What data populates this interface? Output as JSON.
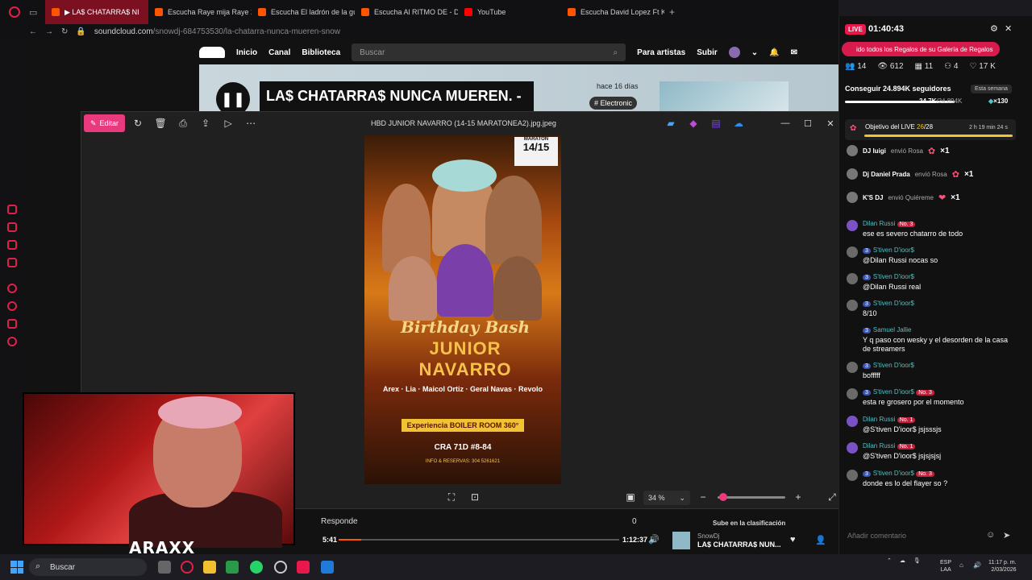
{
  "browser": {
    "tabs": [
      {
        "label": "▶ LA$ CHATARRA$ NI",
        "icon": "soundcloud-icon",
        "active": true
      },
      {
        "label": "Escucha Raye mija Raye 2",
        "icon": "soundcloud-icon"
      },
      {
        "label": "Escucha El ladrón de la gu",
        "icon": "soundcloud-icon"
      },
      {
        "label": "Escucha Al RITMO DE - D",
        "icon": "soundcloud-icon"
      },
      {
        "label": "YouTube",
        "icon": "youtube-icon"
      },
      {
        "label": "Escucha David Lopez Ft K",
        "icon": "soundcloud-icon"
      }
    ],
    "url_host": "soundcloud.com",
    "url_path": "/snowdj-684753530/la-chatarra-nunca-mueren-snow"
  },
  "soundcloud": {
    "nav": [
      "Inicio",
      "Canal",
      "Biblioteca"
    ],
    "search_placeholder": "Buscar",
    "para_artistas": "Para artistas",
    "subir": "Subir",
    "hero_title": "LA$ CHATARRA$ NUNCA MUEREN. -",
    "hero_ago": "hace 16 días",
    "hero_tag": "# Electronic",
    "responde": "Responde",
    "responde_count": "0",
    "sube": "Sube en la clasificación",
    "time_current": "5:41",
    "time_total": "1:12:37",
    "progress": 0.08,
    "track_user": "SnowDj",
    "track_title": "LA$ CHATARRA$ NUN..."
  },
  "viewer": {
    "edit_label": "Editar",
    "title": "HBD JUNIOR NAVARRO (14-15 MARATONEA2).jpg.jpeg",
    "zoom": "34 %",
    "zoom_level": 0.05,
    "poster": {
      "date_label": "MARATÓN",
      "date": "14/15",
      "bday": "Birthday Bash",
      "name": "JUNIOR NAVARRO",
      "artists": "Arex · Lia · Maicol Ortiz · Geral Navas · Revolo",
      "experience": "Experiencia BOILER ROOM 360°",
      "address": "CRA 71D #8-84",
      "info": "INFO & RESERVAS: 304 5261621"
    }
  },
  "webcam": {
    "logo": "ARAXX"
  },
  "live": {
    "badge": "LIVE",
    "time": "01:40:43",
    "gifts_banner": "ido todos los Regalos de su Galería de Regalos",
    "stats": [
      "14",
      "612",
      "11",
      "4",
      "17 K"
    ],
    "goal": "Conseguir 24.894K seguidores",
    "goal_period": "Esta semana",
    "goal_current": "24.7K",
    "goal_target": "/24.894K",
    "goal_coins": "×130",
    "objective_label": "Objetivo del LIVE",
    "objective_current": "26",
    "objective_total": "/28",
    "objective_time": "2 h 19 min 24 s",
    "gifts": [
      {
        "user": "DJ luigi",
        "action": "envió Rosa",
        "count": "×1"
      },
      {
        "user": "Dj Daniel Prada",
        "action": "envió Rosa",
        "count": "×1"
      },
      {
        "user": "K'S DJ",
        "action": "envió Quiéreme",
        "count": "×1"
      }
    ],
    "messages": [
      {
        "name": "Dilan Russi",
        "badge": "No. 3",
        "text": "ese es severo chatarro de todo"
      },
      {
        "name": "S'tiven D'ioor$",
        "badge": "3",
        "text": "@Dilan Russi nocas so"
      },
      {
        "name": "S'tiven D'ioor$",
        "badge": "3",
        "text": "@Dilan Russi real"
      },
      {
        "name": "S'tiven D'ioor$",
        "badge": "3",
        "text": "8/10"
      },
      {
        "name": "Samuel Jallie",
        "badge": "3",
        "text": "Y q paso con wesky y el desorden de la casa de streamers"
      },
      {
        "name": "S'tiven D'ioor$",
        "badge": "3",
        "text": "bofffff"
      },
      {
        "name": "S'tiven D'ioor$",
        "badge": "No. 3",
        "text": "esta re grosero por el momento"
      },
      {
        "name": "Dilan Russi",
        "badge": "No. 1",
        "text": "@S'tiven D'ioor$ jsjsssjs"
      },
      {
        "name": "Dilan Russi",
        "badge": "No. 1",
        "text": "@S'tiven D'ioor$ jsjsjsjsj"
      },
      {
        "name": "S'tiven D'ioor$",
        "badge": "No. 3",
        "text": "donde es lo del flayer so ?"
      }
    ],
    "comment_placeholder": "Añadir comentario"
  },
  "taskbar": {
    "search": "Buscar",
    "lang1": "ESP",
    "lang2": "LAA",
    "time": "11:17 p. m.",
    "date": "2/03/2026"
  }
}
